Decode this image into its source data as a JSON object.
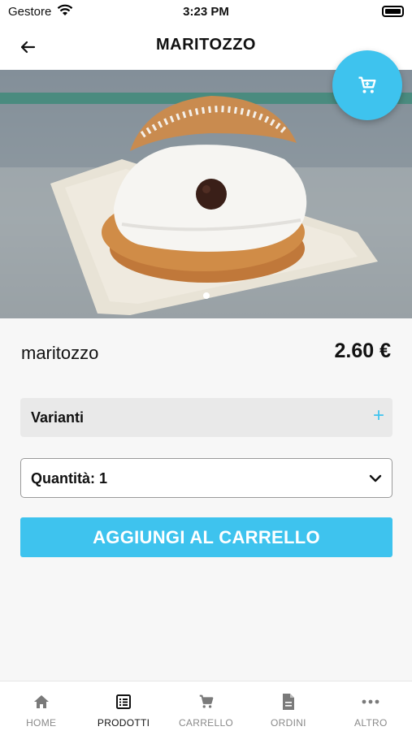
{
  "status_bar": {
    "carrier": "Gestore",
    "time": "3:23 PM"
  },
  "header": {
    "title": "MARITOZZO"
  },
  "hero": {
    "image_alt": "maritozzo",
    "slide_count": 1,
    "active_slide": 1
  },
  "product": {
    "name": "maritozzo",
    "price": "2.60 €"
  },
  "variants": {
    "label": "Varianti",
    "toggle": "+"
  },
  "quantity": {
    "label": "Quantità: 1"
  },
  "add_to_cart": {
    "label": "AGGIUNGI AL CARRELLO"
  },
  "tabs": [
    {
      "label": "HOME",
      "icon": "home-icon",
      "active": false
    },
    {
      "label": "PRODOTTI",
      "icon": "list-icon",
      "active": true
    },
    {
      "label": "CARRELLO",
      "icon": "cart-icon",
      "active": false
    },
    {
      "label": "ORDINI",
      "icon": "document-icon",
      "active": false
    },
    {
      "label": "ALTRO",
      "icon": "more-icon",
      "active": false
    }
  ],
  "colors": {
    "accent": "#3ec3ee",
    "background": "#f7f7f7",
    "variants_bg": "#e9e9e9"
  }
}
